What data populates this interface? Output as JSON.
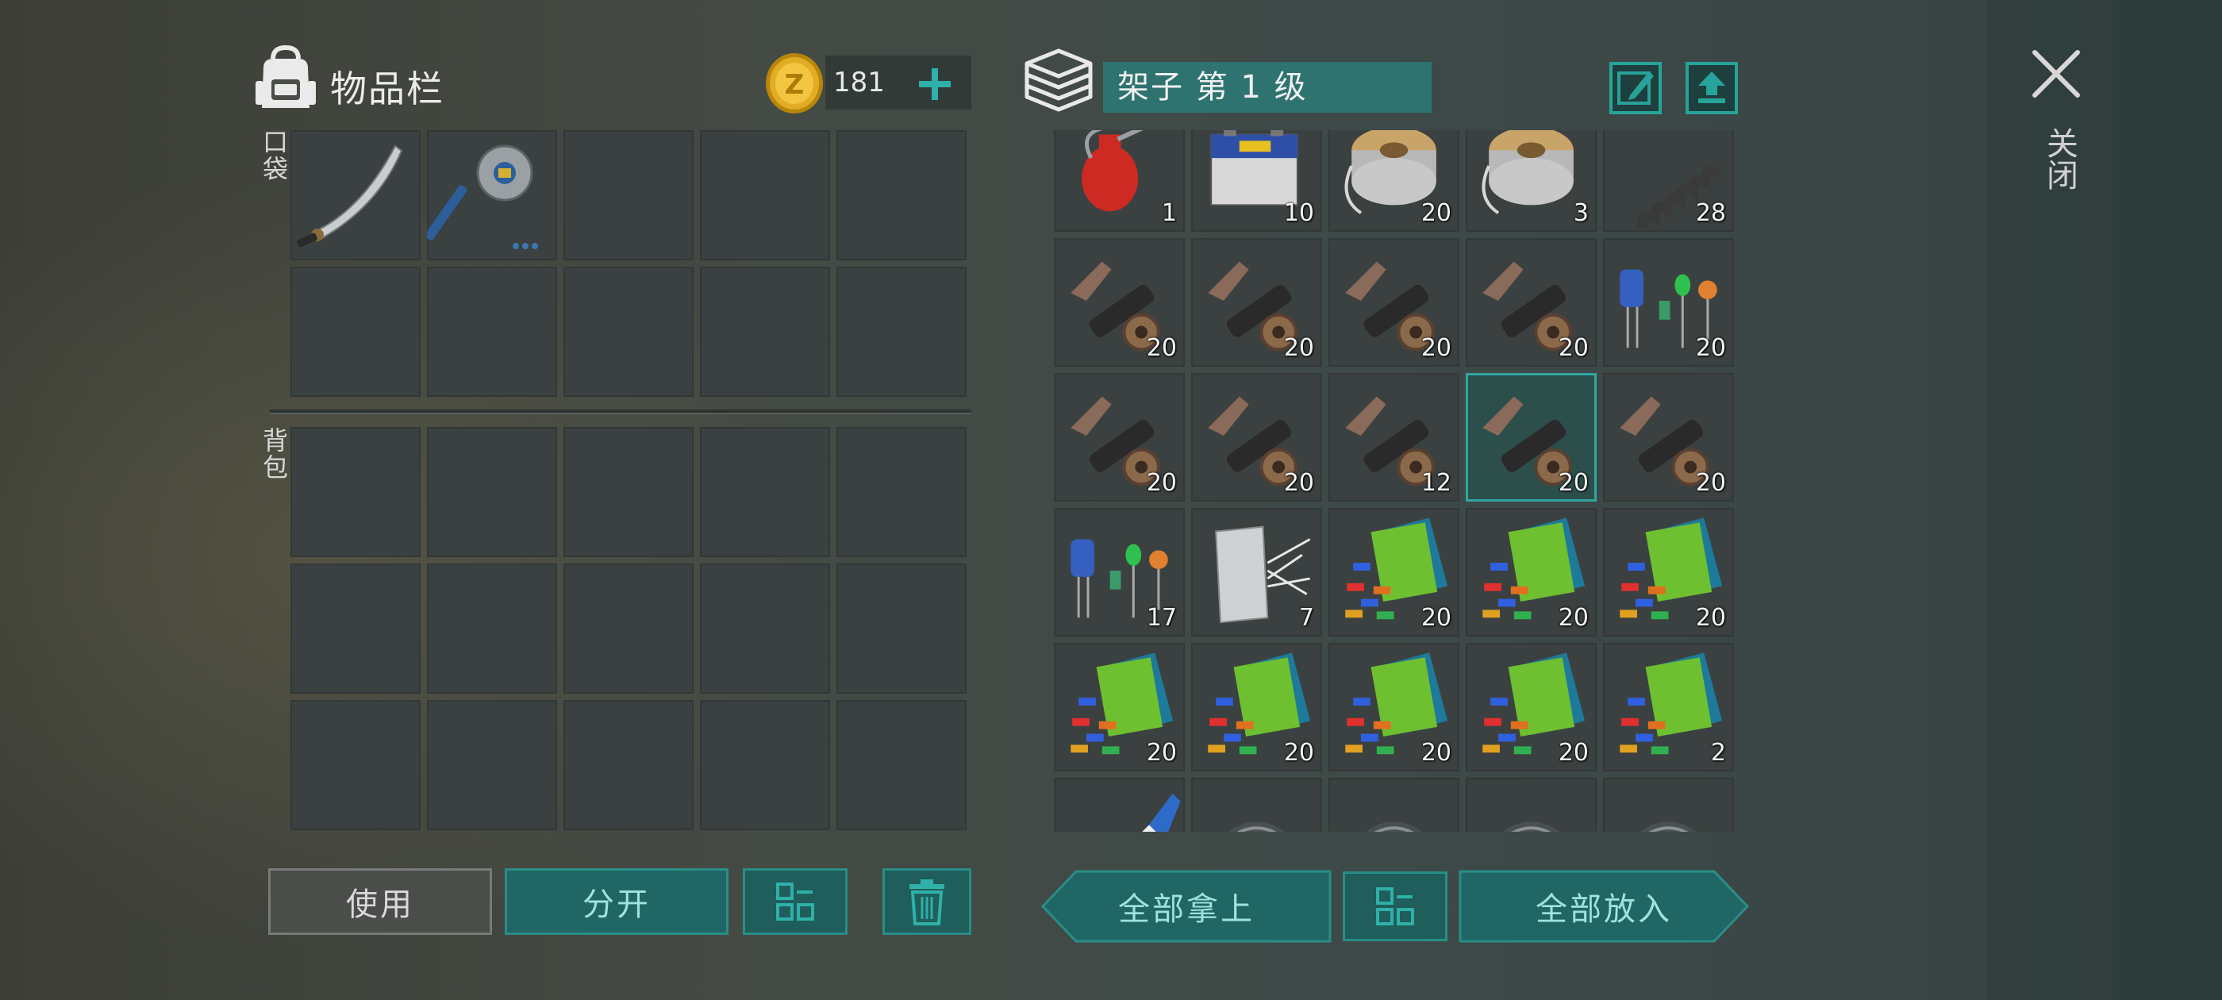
{
  "inventory": {
    "title": "物品栏",
    "coins": "181",
    "pocket_label": "口袋",
    "backpack_label": "背包",
    "pocket_slots": [
      {
        "item": "machete-icon",
        "qty": ""
      },
      {
        "item": "sawblade-mace-icon",
        "qty": ""
      },
      {
        "item": "",
        "qty": ""
      },
      {
        "item": "",
        "qty": ""
      },
      {
        "item": "",
        "qty": ""
      },
      {
        "item": "",
        "qty": ""
      },
      {
        "item": "",
        "qty": ""
      },
      {
        "item": "",
        "qty": ""
      },
      {
        "item": "",
        "qty": ""
      },
      {
        "item": "",
        "qty": ""
      }
    ]
  },
  "storage": {
    "title": "架子 第 1 级",
    "slots": [
      {
        "item": "oil-can-icon",
        "qty": "1"
      },
      {
        "item": "battery-icon",
        "qty": "10"
      },
      {
        "item": "wire-spool-icon",
        "qty": "20"
      },
      {
        "item": "wire-spool-icon",
        "qty": "3"
      },
      {
        "item": "spring-icon",
        "qty": "28"
      },
      {
        "item": "gun-parts-icon",
        "qty": "20"
      },
      {
        "item": "gun-parts-icon",
        "qty": "20"
      },
      {
        "item": "gun-parts-icon",
        "qty": "20"
      },
      {
        "item": "gun-parts-icon",
        "qty": "20"
      },
      {
        "item": "electronic-parts-icon",
        "qty": "20"
      },
      {
        "item": "gun-parts-icon",
        "qty": "20"
      },
      {
        "item": "gun-parts-icon",
        "qty": "20"
      },
      {
        "item": "gun-parts-icon",
        "qty": "12"
      },
      {
        "item": "gun-parts-icon",
        "qty": "20"
      },
      {
        "item": "gun-parts-icon",
        "qty": "20"
      },
      {
        "item": "electronic-parts-icon",
        "qty": "17"
      },
      {
        "item": "fiberglass-icon",
        "qty": "7"
      },
      {
        "item": "circuit-parts-icon",
        "qty": "20"
      },
      {
        "item": "circuit-parts-icon",
        "qty": "20"
      },
      {
        "item": "circuit-parts-icon",
        "qty": "20"
      },
      {
        "item": "circuit-parts-icon",
        "qty": "20"
      },
      {
        "item": "circuit-parts-icon",
        "qty": "20"
      },
      {
        "item": "circuit-parts-icon",
        "qty": "20"
      },
      {
        "item": "circuit-parts-icon",
        "qty": "20"
      },
      {
        "item": "circuit-parts-icon",
        "qty": "2"
      },
      {
        "item": "glue-icon",
        "qty": ""
      },
      {
        "item": "bearing-icon",
        "qty": ""
      },
      {
        "item": "bearing-icon",
        "qty": ""
      },
      {
        "item": "bearing-icon",
        "qty": ""
      },
      {
        "item": "bearing-icon",
        "qty": ""
      }
    ],
    "selected_index": 13
  },
  "buttons": {
    "use": "使用",
    "split": "分开",
    "take_all": "全部拿上",
    "put_all": "全部放入",
    "close": "关闭"
  },
  "colors": {
    "accent": "#2fa6a0",
    "field": "#2e7370",
    "slot": "#3b4140"
  }
}
